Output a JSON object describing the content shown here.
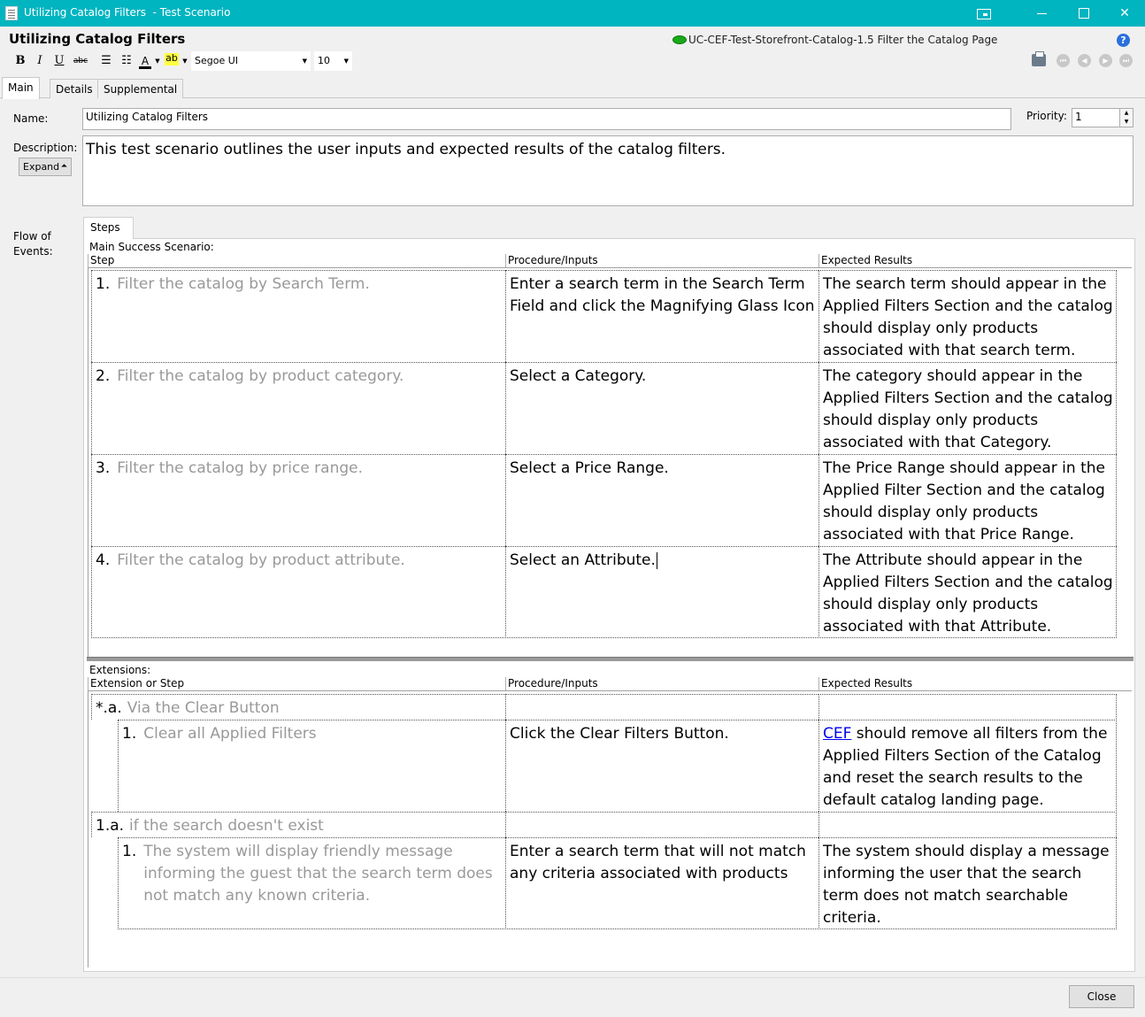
{
  "window": {
    "title": "Utilizing Catalog Filters  - Test Scenario"
  },
  "header": {
    "doc_title": "Utilizing Catalog Filters",
    "use_case": "UC-CEF-Test-Storefront-Catalog-1.5 Filter the Catalog Page"
  },
  "toolbar": {
    "bold": "B",
    "italic": "I",
    "underline": "U",
    "strike": "abc",
    "font_color": "A",
    "highlight": "ab",
    "font": "Segoe UI",
    "size": "10"
  },
  "tabs": [
    {
      "label": "Main"
    },
    {
      "label": "Details"
    },
    {
      "label": "Supplemental"
    }
  ],
  "form": {
    "name_label": "Name:",
    "name_value": "Utilizing Catalog Filters",
    "priority_label": "Priority:",
    "priority_value": "1",
    "description_label": "Description:",
    "expand_label": "Expand",
    "description_value": "This test scenario outlines the user inputs and expected results of the catalog filters.",
    "flow_label_1": "Flow of",
    "flow_label_2": "Events:"
  },
  "steps_tab": "Steps",
  "main_scenario": {
    "label": "Main Success Scenario:",
    "columns": [
      "Step",
      "Procedure/Inputs",
      "Expected Results"
    ],
    "rows": [
      {
        "num": "1.",
        "step": "Filter the catalog by Search Term.",
        "procedure": "Enter a search term in the Search Term Field and click the Magnifying Glass Icon",
        "expected": "The search term should appear in the Applied Filters Section and the catalog should display only products associated with that search term."
      },
      {
        "num": "2.",
        "step": "Filter the catalog by product category.",
        "procedure": "Select a Category.",
        "expected": "The category should appear in the Applied Filters Section and the catalog should display only products associated with that Category."
      },
      {
        "num": "3.",
        "step": "Filter the catalog by price range.",
        "procedure": "Select a Price Range.",
        "expected": "The Price Range should appear in the Applied Filter Section and the catalog should display only products associated with that Price Range."
      },
      {
        "num": "4.",
        "step": "Filter the catalog by product attribute.",
        "procedure": "Select an Attribute.",
        "expected": "The Attribute should appear in the Applied Filters Section and the catalog should display only products associated with that Attribute."
      }
    ]
  },
  "extensions": {
    "label": "Extensions:",
    "columns": [
      "Extension or Step",
      "Procedure/Inputs",
      "Expected Results"
    ],
    "ext_a": {
      "num": "*.a.",
      "title": "Via the Clear Button"
    },
    "ext_a_step": {
      "num": "1.",
      "step": "Clear all Applied Filters",
      "procedure": "Click the Clear Filters Button.",
      "expected_link": "CEF",
      "expected_rest": " should remove all filters from the Applied Filters Section of the Catalog and reset the search results to the default catalog landing page."
    },
    "ext_b": {
      "num": "1.a.",
      "title": "if the search doesn't exist"
    },
    "ext_b_step": {
      "num": "1.",
      "step": "The system will display friendly message informing the guest that the search term does not match any known criteria.",
      "procedure": "Enter a search term that will not match any criteria associated with products",
      "expected": "The system should display a message informing the user that the search term does not match searchable criteria."
    }
  },
  "footer": {
    "close_label": "Close"
  },
  "colors": {
    "titlebar": "#00b4c0",
    "step_text": "#999999",
    "status_green": "#18a818"
  }
}
